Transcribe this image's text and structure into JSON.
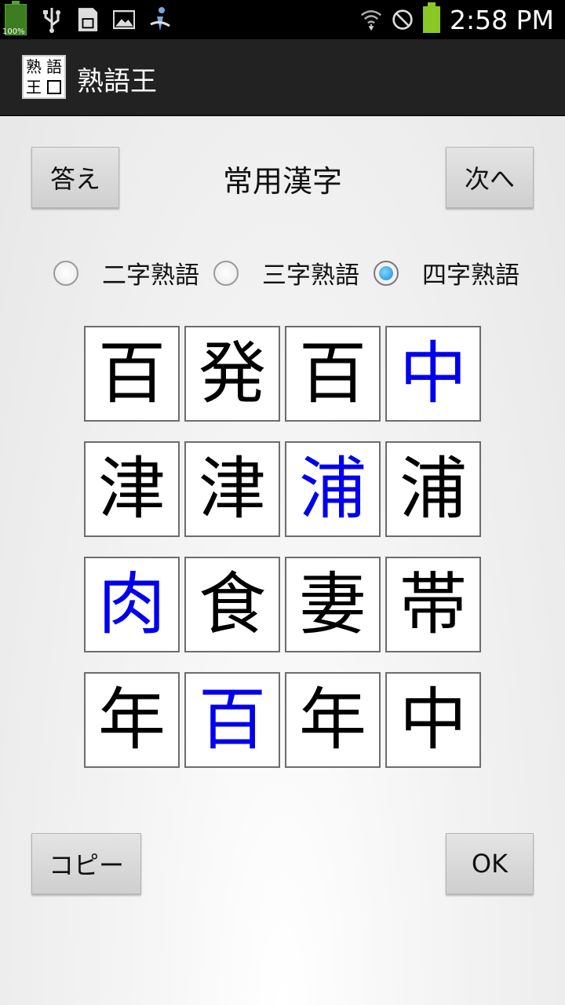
{
  "status_bar": {
    "battery_left_label": "100%",
    "time": "2:58 PM",
    "icons": [
      "battery-icon",
      "usb-icon",
      "sd-card-icon",
      "image-icon",
      "sync-icon",
      "wifi-icon",
      "no-signal-icon",
      "battery-icon"
    ]
  },
  "app": {
    "icon_chars": [
      "熟",
      "語",
      "王"
    ],
    "title": "熟語王"
  },
  "toolbar": {
    "answer_label": "答え",
    "category": "常用漢字",
    "next_label": "次へ"
  },
  "modes": [
    {
      "label": "二字熟語",
      "selected": false
    },
    {
      "label": "三字熟語",
      "selected": false
    },
    {
      "label": "四字熟語",
      "selected": true
    }
  ],
  "grid": {
    "rows": [
      [
        {
          "char": "百",
          "highlight": false
        },
        {
          "char": "発",
          "highlight": false
        },
        {
          "char": "百",
          "highlight": false
        },
        {
          "char": "中",
          "highlight": true
        }
      ],
      [
        {
          "char": "津",
          "highlight": false
        },
        {
          "char": "津",
          "highlight": false
        },
        {
          "char": "浦",
          "highlight": true
        },
        {
          "char": "浦",
          "highlight": false
        }
      ],
      [
        {
          "char": "肉",
          "highlight": true
        },
        {
          "char": "食",
          "highlight": false
        },
        {
          "char": "妻",
          "highlight": false
        },
        {
          "char": "帯",
          "highlight": false
        }
      ],
      [
        {
          "char": "年",
          "highlight": false
        },
        {
          "char": "百",
          "highlight": true
        },
        {
          "char": "年",
          "highlight": false
        },
        {
          "char": "中",
          "highlight": false
        }
      ]
    ],
    "highlight_color": "#0000ee"
  },
  "footer": {
    "copy_label": "コピー",
    "ok_label": "OK"
  }
}
